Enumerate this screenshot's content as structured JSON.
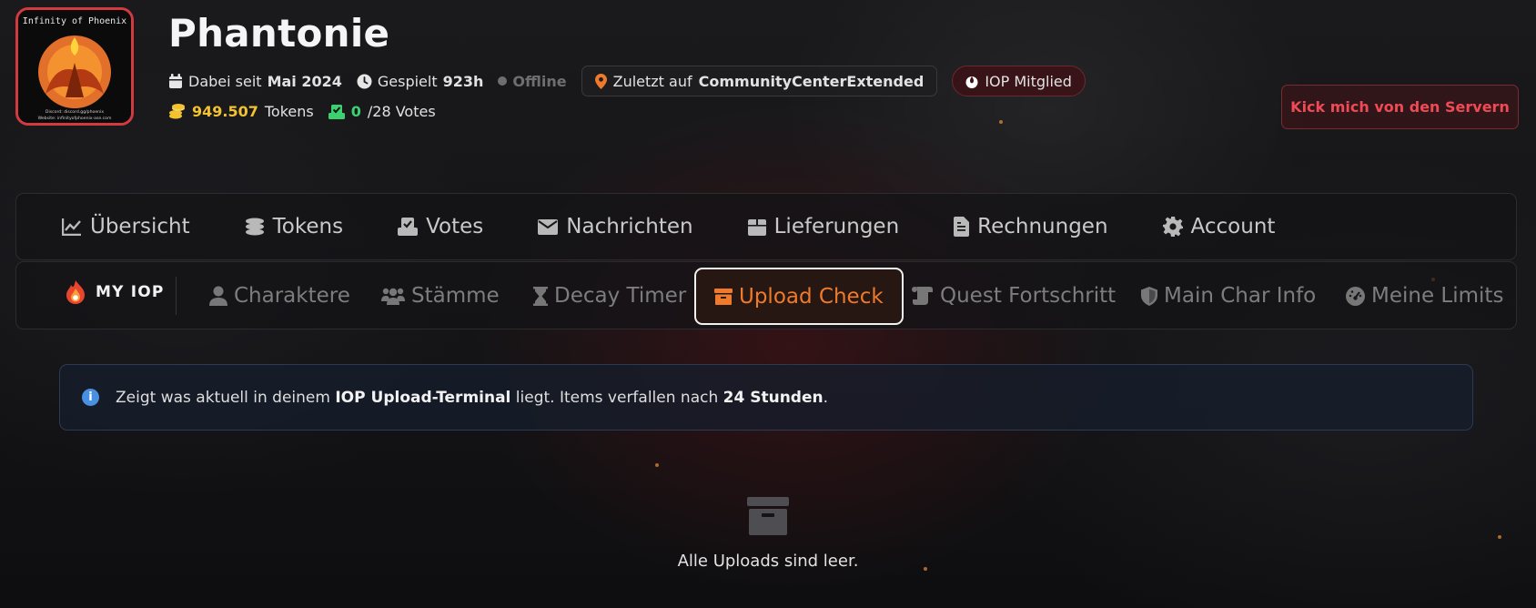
{
  "profile": {
    "logo_text": "Infinity of Phoenix",
    "logo_subtext_1": "Discord: discord.gg/phoenix",
    "logo_subtext_2": "Website: infinityofphoenix-ase.com",
    "name": "Phantonie",
    "joined_label": "Dabei seit",
    "joined_value": "Mai 2024",
    "played_label": "Gespielt",
    "played_value": "923h",
    "status": "Offline",
    "last_seen_label": "Zuletzt auf",
    "last_seen_value": "CommunityCenterExtended",
    "member_badge": "IOP Mitglied",
    "tokens_value": "949.507",
    "tokens_label": "Tokens",
    "votes_value": "0",
    "votes_total": "/28 Votes"
  },
  "kick_button": "Kick mich von den Servern",
  "main_nav": [
    {
      "label": "Übersicht",
      "icon": "chart-line-icon"
    },
    {
      "label": "Tokens",
      "icon": "coins-icon"
    },
    {
      "label": "Votes",
      "icon": "check-box-icon"
    },
    {
      "label": "Nachrichten",
      "icon": "envelope-icon"
    },
    {
      "label": "Lieferungen",
      "icon": "box-icon"
    },
    {
      "label": "Rechnungen",
      "icon": "invoice-icon"
    },
    {
      "label": "Account",
      "icon": "gear-icon"
    }
  ],
  "sub_nav": {
    "brand": "MY IOP",
    "tabs": [
      {
        "label": "Charaktere",
        "icon": "user-icon"
      },
      {
        "label": "Stämme",
        "icon": "users-icon"
      },
      {
        "label": "Decay Timer",
        "icon": "hourglass-icon"
      },
      {
        "label": "Upload Check",
        "icon": "archive-icon",
        "active": true
      },
      {
        "label": "Quest Fortschritt",
        "icon": "scroll-icon"
      },
      {
        "label": "Main Char Info",
        "icon": "shield-icon"
      },
      {
        "label": "Meine Limits",
        "icon": "gauge-icon"
      }
    ]
  },
  "info": {
    "text_1": "Zeigt was aktuell in deinem",
    "bold_1": "IOP Upload-Terminal",
    "text_2": "liegt. Items verfallen nach",
    "bold_2": "24 Stunden",
    "text_3": "."
  },
  "empty_state": "Alle Uploads sind leer.",
  "colors": {
    "accent": "#f07a2b",
    "danger": "#f04a55",
    "tokens": "#f2c230",
    "votes": "#3bd16f",
    "info": "#4a90e2"
  }
}
